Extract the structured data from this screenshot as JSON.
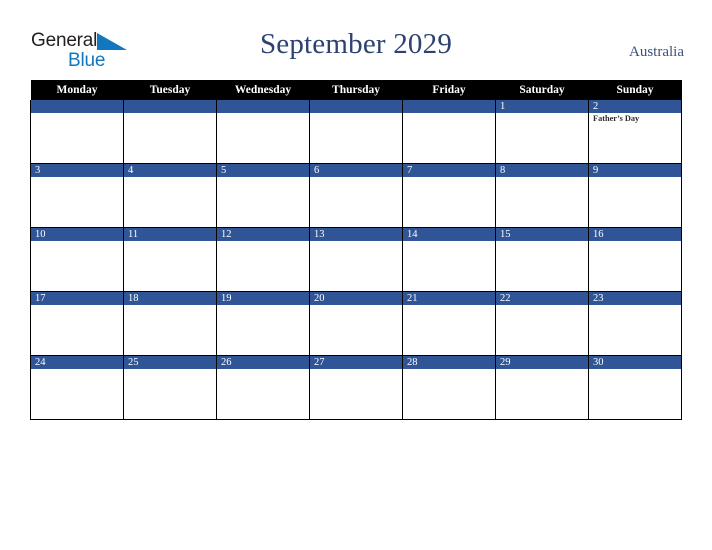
{
  "brand": {
    "name_part1": "General",
    "name_part2": "Blue",
    "triangle_icon": "triangle-icon",
    "color_dark": "#231f20",
    "color_blue": "#1277bf"
  },
  "header": {
    "title": "September 2029",
    "country": "Australia",
    "title_color": "#2e4272"
  },
  "calendar": {
    "weekday_headers": [
      "Monday",
      "Tuesday",
      "Wednesday",
      "Thursday",
      "Friday",
      "Saturday",
      "Sunday"
    ],
    "header_bg": "#000000",
    "daybar_bg": "#2f5597",
    "daybar_text": "#ffffff",
    "weeks": [
      [
        {
          "date": "",
          "events": []
        },
        {
          "date": "",
          "events": []
        },
        {
          "date": "",
          "events": []
        },
        {
          "date": "",
          "events": []
        },
        {
          "date": "",
          "events": []
        },
        {
          "date": "1",
          "events": []
        },
        {
          "date": "2",
          "events": [
            "Father’s Day"
          ]
        }
      ],
      [
        {
          "date": "3",
          "events": []
        },
        {
          "date": "4",
          "events": []
        },
        {
          "date": "5",
          "events": []
        },
        {
          "date": "6",
          "events": []
        },
        {
          "date": "7",
          "events": []
        },
        {
          "date": "8",
          "events": []
        },
        {
          "date": "9",
          "events": []
        }
      ],
      [
        {
          "date": "10",
          "events": []
        },
        {
          "date": "11",
          "events": []
        },
        {
          "date": "12",
          "events": []
        },
        {
          "date": "13",
          "events": []
        },
        {
          "date": "14",
          "events": []
        },
        {
          "date": "15",
          "events": []
        },
        {
          "date": "16",
          "events": []
        }
      ],
      [
        {
          "date": "17",
          "events": []
        },
        {
          "date": "18",
          "events": []
        },
        {
          "date": "19",
          "events": []
        },
        {
          "date": "20",
          "events": []
        },
        {
          "date": "21",
          "events": []
        },
        {
          "date": "22",
          "events": []
        },
        {
          "date": "23",
          "events": []
        }
      ],
      [
        {
          "date": "24",
          "events": []
        },
        {
          "date": "25",
          "events": []
        },
        {
          "date": "26",
          "events": []
        },
        {
          "date": "27",
          "events": []
        },
        {
          "date": "28",
          "events": []
        },
        {
          "date": "29",
          "events": []
        },
        {
          "date": "30",
          "events": []
        }
      ]
    ]
  }
}
